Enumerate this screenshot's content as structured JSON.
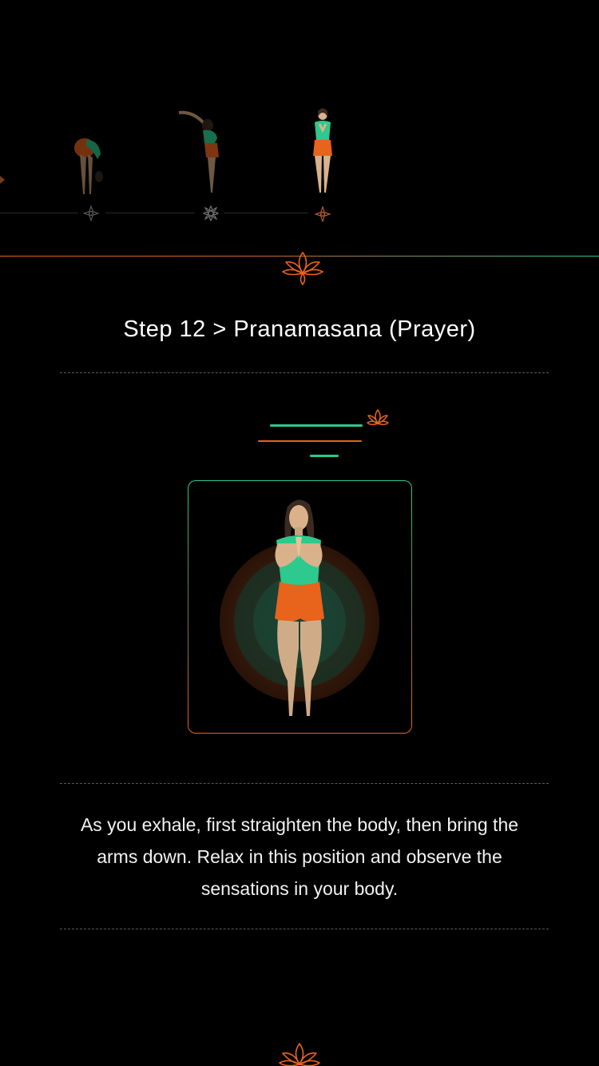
{
  "sequence": {
    "poses": [
      {
        "name": "standing-forward-bend"
      },
      {
        "name": "raised-arms"
      },
      {
        "name": "prayer"
      }
    ]
  },
  "step": {
    "title": "Step 12 > Pranamasana (Prayer)",
    "description": "As you exhale, first straighten the body, then bring the arms down. Relax in this position and observe the sensations in your body."
  },
  "colors": {
    "accent_orange": "#e8631c",
    "accent_green": "#2dc98e",
    "background": "#000000"
  },
  "icons": {
    "lotus": "lotus-icon",
    "step_marker": "flower-icon"
  }
}
